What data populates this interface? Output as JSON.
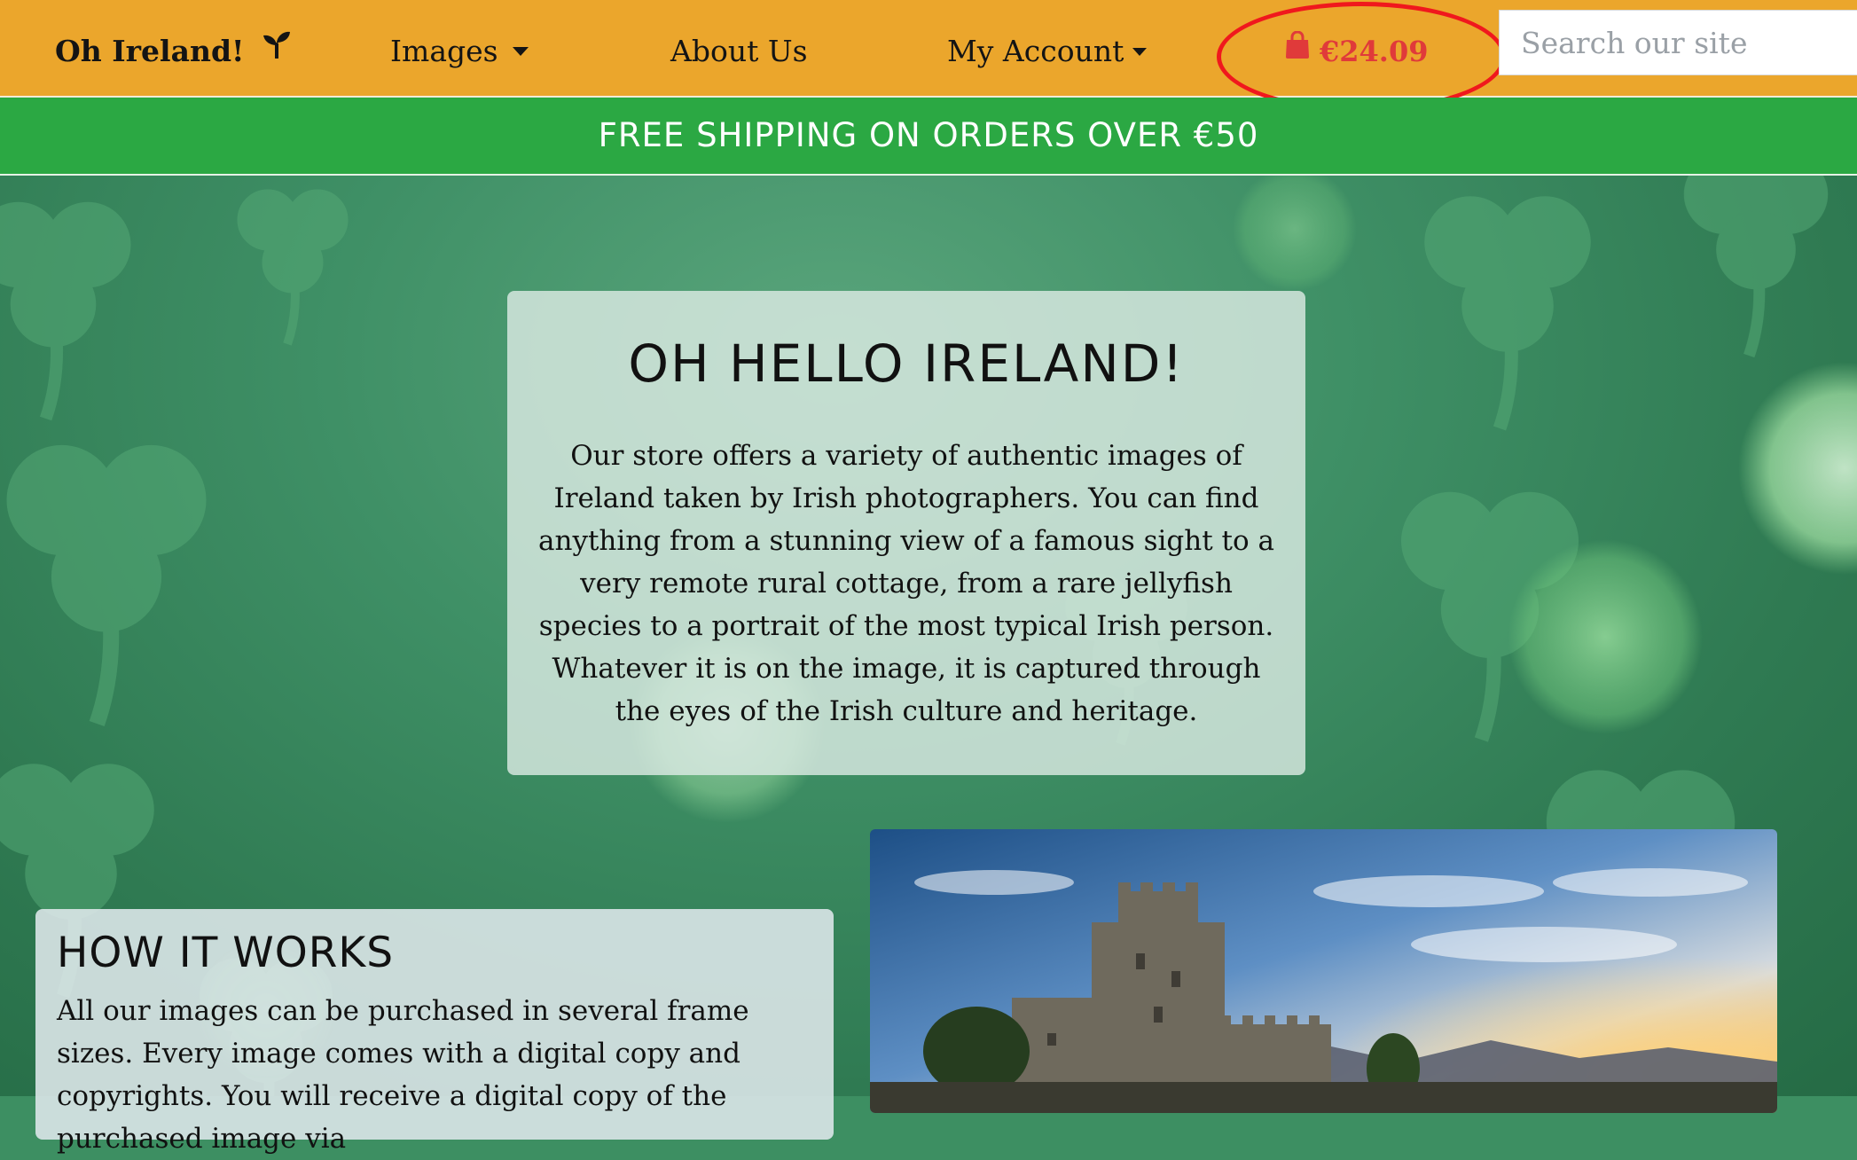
{
  "navbar": {
    "brand": "Oh Ireland!",
    "items": [
      {
        "label": "Images"
      },
      {
        "label": "About Us"
      },
      {
        "label": "My Account"
      }
    ],
    "basket_total": "€24.09",
    "search_placeholder": "Search our site"
  },
  "banner": {
    "text": "FREE SHIPPING ON ORDERS OVER €50"
  },
  "intro": {
    "title": "OH HELLO IRELAND!",
    "text": "Our store offers a variety of authentic images of Ireland taken by Irish photographers. You can find anything from a stunning view of a famous sight to a very remote rural cottage, from a rare jellyfish species to a portrait of the most typical Irish person. Whatever it is on the image, it is captured through the eyes of the Irish culture and heritage."
  },
  "how_it_works": {
    "title": "HOW IT WORKS",
    "text": "All our images can be purchased in several frame sizes. Every image comes with a digital copy and copyrights. You will receive a digital copy of the purchased image via"
  },
  "colors": {
    "navbar": "#eba62c",
    "banner": "#2ba843",
    "basket": "#e03a3a",
    "highlight_ring": "#f0181d"
  },
  "icons": {
    "brand": "seedling-icon",
    "basket": "shopping-bag-icon",
    "dropdown": "caret-down-icon"
  }
}
